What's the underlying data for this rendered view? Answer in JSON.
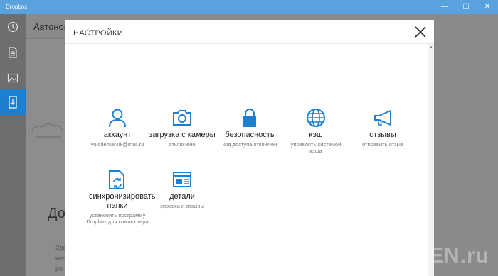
{
  "window": {
    "title": "Dropbox",
    "min": "—",
    "max": "☐",
    "close": "✕"
  },
  "background": {
    "header": "Автоном",
    "big_text": "Дос",
    "small_lines": [
      "Зде",
      "котор",
      "ро"
    ],
    "watermark": "TEN.ru"
  },
  "modal": {
    "title": "НАСТРОЙКИ",
    "tiles": [
      {
        "icon": "person-icon",
        "label": "аккаунт",
        "sub": "volddemar4ik@mail.ru"
      },
      {
        "icon": "camera-icon",
        "label": "загрузка с камеры",
        "sub": "отключено"
      },
      {
        "icon": "lock-icon",
        "label": "безопасность",
        "sub": "код доступа отключен"
      },
      {
        "icon": "globe-icon",
        "label": "кэш",
        "sub": "управлять системой кэша"
      },
      {
        "icon": "megaphone-icon",
        "label": "отзывы",
        "sub": "отправить отзыв"
      },
      {
        "icon": "sync-folder-icon",
        "label": "синхронизировать папки",
        "sub": "установить программу Dropbox для компьютера"
      },
      {
        "icon": "details-icon",
        "label": "детали",
        "sub": "справка и отзывы"
      }
    ]
  },
  "colors": {
    "accent": "#1c7fd0",
    "titlebar": "#5aa2de"
  }
}
